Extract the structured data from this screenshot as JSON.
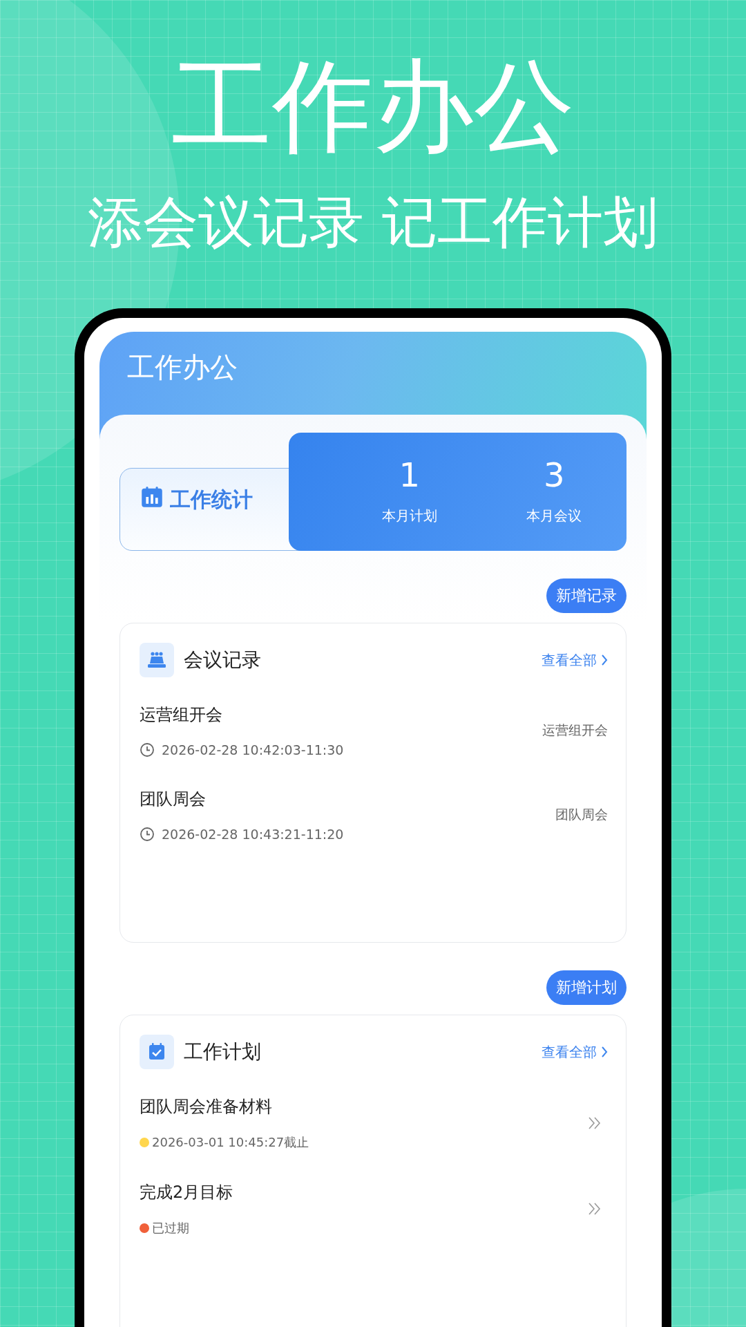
{
  "hero": {
    "title": "工作办公",
    "subtitle": "添会议记录 记工作计划"
  },
  "header": {
    "title": "工作办公"
  },
  "stats": {
    "label": "工作统计",
    "items": [
      {
        "value": "1",
        "label": "本月计划"
      },
      {
        "value": "3",
        "label": "本月会议"
      }
    ]
  },
  "meetings": {
    "add_button": "新增记录",
    "title": "会议记录",
    "view_all": "查看全部",
    "items": [
      {
        "title": "运营组开会",
        "time": "2026-02-28 10:42:03-11:30",
        "tag": "运营组开会"
      },
      {
        "title": "团队周会",
        "time": "2026-02-28 10:43:21-11:20",
        "tag": "团队周会"
      }
    ]
  },
  "plans": {
    "add_button": "新增计划",
    "title": "工作计划",
    "view_all": "查看全部",
    "items": [
      {
        "title": "团队周会准备材料",
        "status": "2026-03-01 10:45:27截止",
        "color": "#ffd64d"
      },
      {
        "title": "完成2月目标",
        "status": "已过期",
        "color": "#f0603a"
      }
    ]
  }
}
